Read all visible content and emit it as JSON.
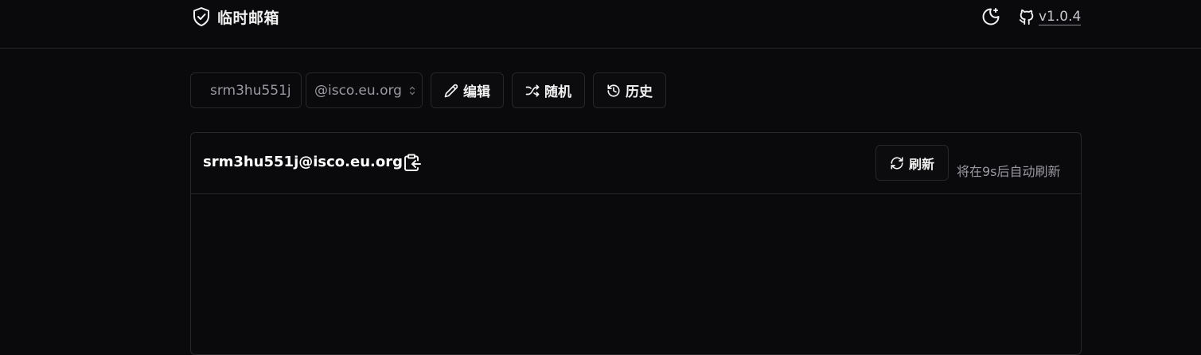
{
  "header": {
    "title": "临时邮箱",
    "version": "v1.0.4"
  },
  "toolbar": {
    "name_value": "srm3hu551j",
    "domain_value": "@isco.eu.org",
    "edit_label": "编辑",
    "random_label": "随机",
    "history_label": "历史"
  },
  "mailbox": {
    "address": "srm3hu551j@isco.eu.org",
    "refresh_label": "刷新",
    "auto_refresh_text": "将在9s后自动刷新"
  },
  "icons": {
    "brand": "shield-check-icon",
    "theme": "moon-icon",
    "repo": "github-icon",
    "edit": "pencil-icon",
    "random": "shuffle-icon",
    "history": "history-icon",
    "copy": "clipboard-copy-icon",
    "refresh": "refresh-icon"
  }
}
